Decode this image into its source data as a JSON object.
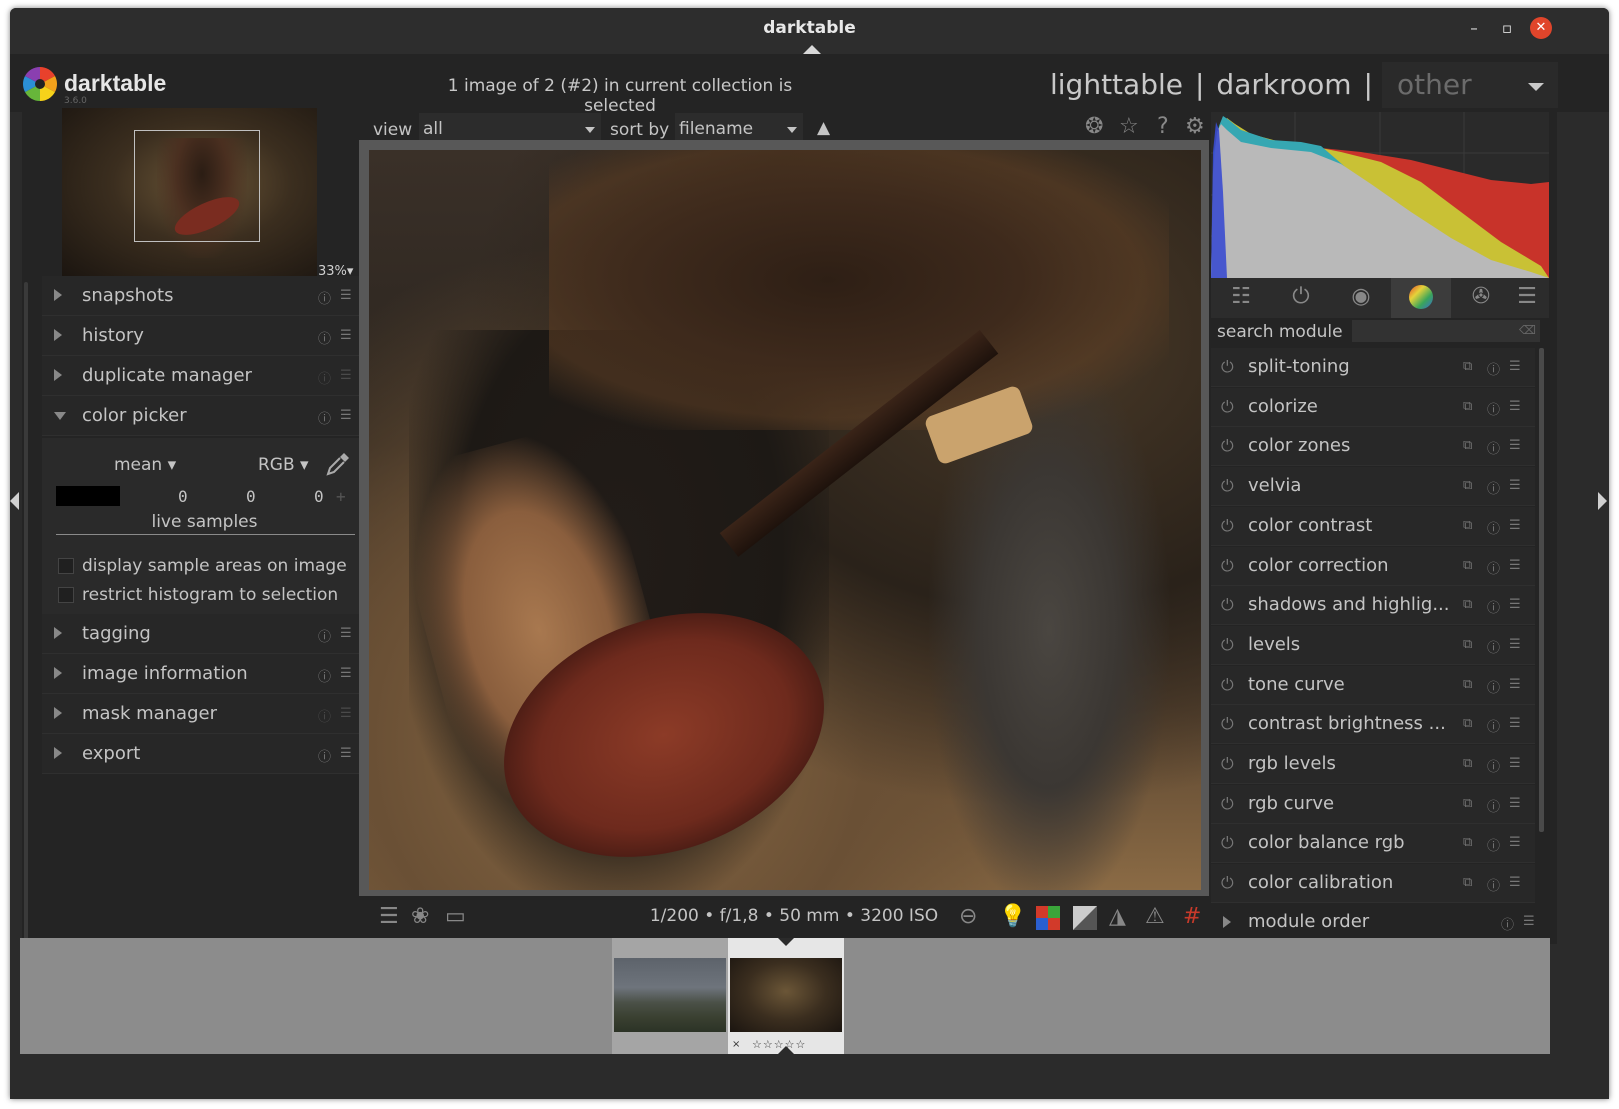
{
  "window": {
    "title": "darktable"
  },
  "app": {
    "name": "darktable",
    "version": "3.6.0"
  },
  "header": {
    "selection_info": "1 image of 2 (#2) in current collection is selected",
    "views": [
      "lighttable",
      "darkroom"
    ],
    "view_separator": "|",
    "other_label": "other"
  },
  "navigation": {
    "zoom": "33%"
  },
  "left_modules": [
    {
      "label": "snapshots",
      "expanded": false
    },
    {
      "label": "history",
      "expanded": false
    },
    {
      "label": "duplicate manager",
      "expanded": false
    },
    {
      "label": "color picker",
      "expanded": true
    },
    {
      "label": "tagging",
      "expanded": false
    },
    {
      "label": "image information",
      "expanded": false
    },
    {
      "label": "mask manager",
      "expanded": false
    },
    {
      "label": "export",
      "expanded": false
    }
  ],
  "color_picker": {
    "mode": "mean",
    "colorspace": "RGB",
    "values": [
      "0",
      "0",
      "0"
    ],
    "live_samples_label": "live samples",
    "display_sample_areas_label": "display sample areas on image",
    "restrict_histogram_label": "restrict histogram to selection",
    "plus": "+"
  },
  "toolbar": {
    "view_label": "view",
    "view_value": "all",
    "sort_label": "sort by",
    "sort_value": "filename",
    "sort_dir": "▲"
  },
  "exif": "1/200 • f/1,8 • 50 mm • 3200 ISO",
  "right_panel": {
    "search_label": "search module",
    "search_clear": "⌫",
    "modules": [
      "split-toning",
      "colorize",
      "color zones",
      "velvia",
      "color contrast",
      "color correction",
      "shadows and highlig...",
      "levels",
      "tone curve",
      "contrast brightness ...",
      "rgb levels",
      "rgb curve",
      "color balance rgb",
      "color calibration"
    ],
    "module_order_label": "module order"
  },
  "filmstrip": {
    "stars": "☆☆☆☆☆",
    "reject": "×"
  },
  "colors": {
    "background": "#2b2b2b",
    "panel": "#242424",
    "text": "#c4c4c4",
    "close_button": "#e0452b"
  }
}
